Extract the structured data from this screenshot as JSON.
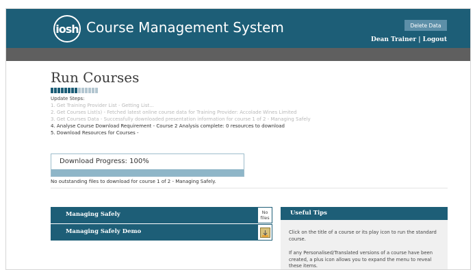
{
  "header": {
    "logo_text": "iosh",
    "app_title": "Course Management System",
    "delete_label": "Delete Data",
    "user_name": "Dean Trainer",
    "separator": "|",
    "logout_label": "Logout",
    "color": "#1d5e77"
  },
  "page": {
    "title": "Run Courses",
    "steps_total": 14,
    "steps_done": 8,
    "update_title": "Update Steps:",
    "steps": [
      {
        "text": "1. Get Training Provider List - Getting List...",
        "state": "done"
      },
      {
        "text": "2. Get Courses List(s) - Fetched latest online course data for Training Provider: Accolade Wines Limited",
        "state": "done"
      },
      {
        "text": "3. Get Courses Data - Successfully downloaded presentation information for course 1 of 2 - Managing Safely",
        "state": "done"
      },
      {
        "text": "4. Analyse Course Download Requirement - Course 2 Analysis complete: 0 resources to download",
        "state": "active"
      },
      {
        "text": "5. Download Resources for Courses -",
        "state": "active"
      }
    ],
    "progress_label": "Download Progress: 100%",
    "progress_value": 100,
    "download_note": "No outstanding files to download for course 1 of 2 - Managing Safely."
  },
  "courses": [
    {
      "name": "Managing Safely",
      "status": "No files"
    },
    {
      "name": "Managing Safely Demo",
      "status": "",
      "icon": "play-icon"
    }
  ],
  "tips": {
    "title": "Useful Tips",
    "items": [
      "Click on the title of a course or its play icon to run the standard course.",
      "If any Personalised/Translated versions of a course have been created, a plus icon allows you to expand the menu to reveal these items."
    ]
  }
}
